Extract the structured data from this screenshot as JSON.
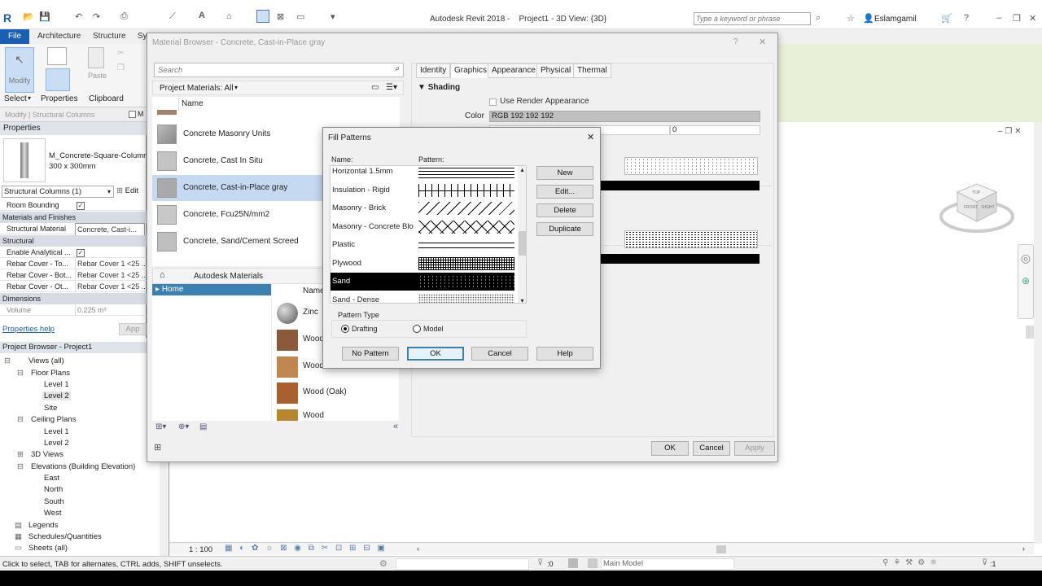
{
  "window": {
    "title": "Autodesk Revit 2018 -    Project1 - 3D View: {3D}",
    "search_placeholder": "Type a keyword or phrase",
    "user": "Eslamgamil"
  },
  "ribbon": {
    "tabs": [
      "File",
      "Architecture",
      "Structure",
      "Sy"
    ],
    "modify_label": "Modify",
    "paste_label": "Paste",
    "select_label": "Select",
    "properties_label": "Properties",
    "clipboard_label": "Clipboard",
    "context_label": "Modify | Structural Columns"
  },
  "properties": {
    "header": "Properties",
    "family_name": "M_Concrete-Square-Column",
    "family_type": "300 x 300mm",
    "selector": "Structural Columns (1)",
    "edit_type": "Edit",
    "room_bounding": "Room Bounding",
    "section_materials": "Materials and Finishes",
    "structural_material_label": "Structural Material",
    "structural_material_value": "Concrete, Cast-i...",
    "section_structural": "Structural",
    "enable_analytical": "Enable Analytical ...",
    "rebar_top": "Rebar Cover - To...",
    "rebar_top_v": "Rebar Cover 1 <25 ...",
    "rebar_bot": "Rebar Cover - Bot...",
    "rebar_bot_v": "Rebar Cover 1 <25 ...",
    "rebar_oth": "Rebar Cover - Ot...",
    "rebar_oth_v": "Rebar Cover 1 <25 ...",
    "section_dimensions": "Dimensions",
    "volume_label": "Volume",
    "volume_value": "0.225 m³",
    "help_link": "Properties help",
    "apply": "App"
  },
  "project_browser": {
    "header": "Project Browser - Project1",
    "views_all": "Views (all)",
    "floor_plans": "Floor Plans",
    "fp_level1": "Level 1",
    "fp_level2": "Level 2",
    "fp_site": "Site",
    "ceiling_plans": "Ceiling Plans",
    "cp_level1": "Level 1",
    "cp_level2": "Level 2",
    "views_3d": "3D Views",
    "elevations": "Elevations (Building Elevation)",
    "east": "East",
    "north": "North",
    "south": "South",
    "west": "West",
    "legends": "Legends",
    "schedules": "Schedules/Quantities",
    "sheets": "Sheets (all)"
  },
  "status": {
    "text": "Click to select, TAB for alternates, CTRL adds, SHIFT unselects.",
    "scale": "1 : 100",
    "model": "Main Model",
    "filter_count": ":0",
    "selection_count": ":1"
  },
  "material_browser": {
    "title": "Material Browser - Concrete, Cast-in-Place gray",
    "search_placeholder": "Search",
    "project_filter": "Project Materials: All",
    "name_header": "Name",
    "materials": [
      "Concrete Masonry Units",
      "Concrete, Cast In Situ",
      "Concrete, Cast-in-Place gray",
      "Concrete, Fcu25N/mm2",
      "Concrete, Sand/Cement Screed"
    ],
    "library_breadcrumb": "Autodesk Materials",
    "library_home": "Home",
    "library_name_header": "Name",
    "library_items": [
      "Zinc",
      "Wood",
      "Wood",
      "Wood (Oak)",
      "Wood"
    ],
    "tabs": [
      "Identity",
      "Graphics",
      "Appearance",
      "Physical",
      "Thermal"
    ],
    "shading_header": "Shading",
    "use_render": "Use Render Appearance",
    "color_label": "Color",
    "color_value": "RGB 192 192 192",
    "transparency_value": "0",
    "ok": "OK",
    "cancel": "Cancel",
    "apply": "Apply"
  },
  "fill_patterns": {
    "title": "Fill Patterns",
    "col_name": "Name:",
    "col_pattern": "Pattern:",
    "items": [
      {
        "name": "Horizontal 1.5mm",
        "pattern": "horizontal"
      },
      {
        "name": "Insulation - Rigid",
        "pattern": "insulation"
      },
      {
        "name": "Masonry - Brick",
        "pattern": "diagonal"
      },
      {
        "name": "Masonry - Concrete  Blo",
        "pattern": "crosshatch"
      },
      {
        "name": "Plastic",
        "pattern": "double-line"
      },
      {
        "name": "Plywood",
        "pattern": "plywood"
      },
      {
        "name": "Sand",
        "pattern": "sand"
      },
      {
        "name": "Sand - Dense",
        "pattern": "sand-dense"
      }
    ],
    "selected": "Sand",
    "new": "New",
    "edit": "Edit...",
    "delete": "Delete",
    "duplicate": "Duplicate",
    "pattern_type": "Pattern Type",
    "drafting": "Drafting",
    "model": "Model",
    "no_pattern": "No Pattern",
    "ok": "OK",
    "cancel": "Cancel",
    "help": "Help"
  },
  "viewcube": {
    "front": "FRONT",
    "right": "RIGHT",
    "top": "TOP"
  }
}
